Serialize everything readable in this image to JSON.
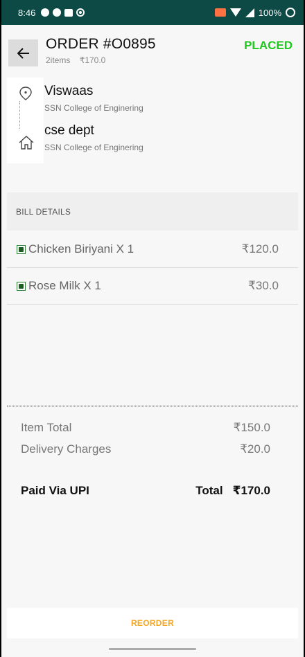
{
  "status_bar": {
    "time": "8:46",
    "battery": "100%"
  },
  "header": {
    "order_title": "ORDER #O0895",
    "items_count": "2items",
    "amount": "₹170.0",
    "status": "PLACED",
    "status_color": "#1ec81e"
  },
  "addresses": {
    "pickup": {
      "name": "Viswaas",
      "place": "SSN College of Enginering"
    },
    "drop": {
      "name": "cse dept",
      "place": "SSN College of Enginering"
    }
  },
  "bill": {
    "header": "BILL DETAILS",
    "items": [
      {
        "name": "Chicken Biriyani X 1",
        "price": "₹120.0"
      },
      {
        "name": "Rose Milk X 1",
        "price": "₹30.0"
      }
    ]
  },
  "summary": {
    "item_total_label": "Item Total",
    "item_total_value": "₹150.0",
    "delivery_label": "Delivery Charges",
    "delivery_value": "₹20.0",
    "payment_label": "Paid Via UPI",
    "total_label": "Total",
    "total_value": "₹170.0"
  },
  "actions": {
    "reorder": "REORDER",
    "reorder_color": "#f5a623"
  }
}
